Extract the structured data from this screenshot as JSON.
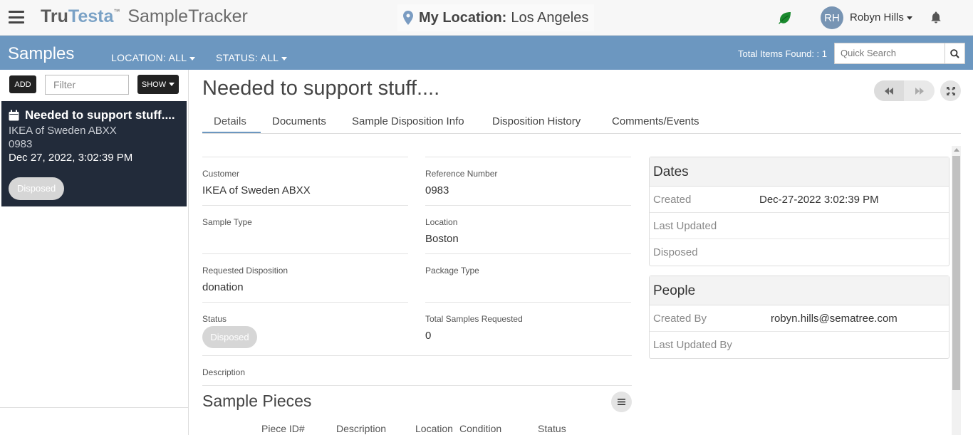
{
  "header": {
    "brand_tru": "Tru",
    "brand_testa": "Testa",
    "brand_tm": "™",
    "brand_app": "SampleTracker",
    "location_label": "My Location:",
    "location_value": "Los Angeles",
    "avatar_initials": "RH",
    "user_name": "Robyn Hills"
  },
  "toolbar": {
    "title": "Samples",
    "location_filter": "LOCATION: ALL",
    "status_filter": "STATUS: ALL",
    "total_items": "Total Items Found: : 1",
    "quick_search_placeholder": "Quick Search"
  },
  "left": {
    "add_label": "ADD",
    "filter_placeholder": "Filter",
    "show_label": "SHOW",
    "card": {
      "title": "Needed to support stuff....",
      "customer": "IKEA of Sweden ABXX",
      "ref": "0983",
      "date": "Dec 27, 2022, 3:02:39 PM",
      "status": "Disposed"
    }
  },
  "main": {
    "title": "Needed to support stuff....",
    "tabs": [
      "Details",
      "Documents",
      "Sample Disposition Info",
      "Disposition History",
      "Comments/Events"
    ],
    "fields": {
      "customer_label": "Customer",
      "customer_value": "IKEA of Sweden ABXX",
      "ref_label": "Reference Number",
      "ref_value": "0983",
      "sample_type_label": "Sample Type",
      "sample_type_value": "",
      "location_label": "Location",
      "location_value": "Boston",
      "req_disp_label": "Requested Disposition",
      "req_disp_value": "donation",
      "package_label": "Package Type",
      "package_value": "",
      "status_label": "Status",
      "status_value": "Disposed",
      "total_req_label": "Total Samples Requested",
      "total_req_value": "0",
      "description_label": "Description"
    },
    "sample_pieces": {
      "title": "Sample Pieces",
      "columns": [
        "Piece ID#",
        "Description",
        "Location",
        "Condition",
        "Status"
      ]
    }
  },
  "dates": {
    "title": "Dates",
    "created_label": "Created",
    "created_value": "Dec-27-2022 3:02:39 PM",
    "updated_label": "Last Updated",
    "updated_value": "",
    "disposed_label": "Disposed",
    "disposed_value": ""
  },
  "people": {
    "title": "People",
    "created_by_label": "Created By",
    "created_by_value": "robyn.hills@sematree.com",
    "updated_by_label": "Last Updated By",
    "updated_by_value": ""
  },
  "colors": {
    "toolbar_bg": "#6c97c0",
    "card_bg": "#222b3a",
    "badge_bg": "#d6d6d6"
  }
}
